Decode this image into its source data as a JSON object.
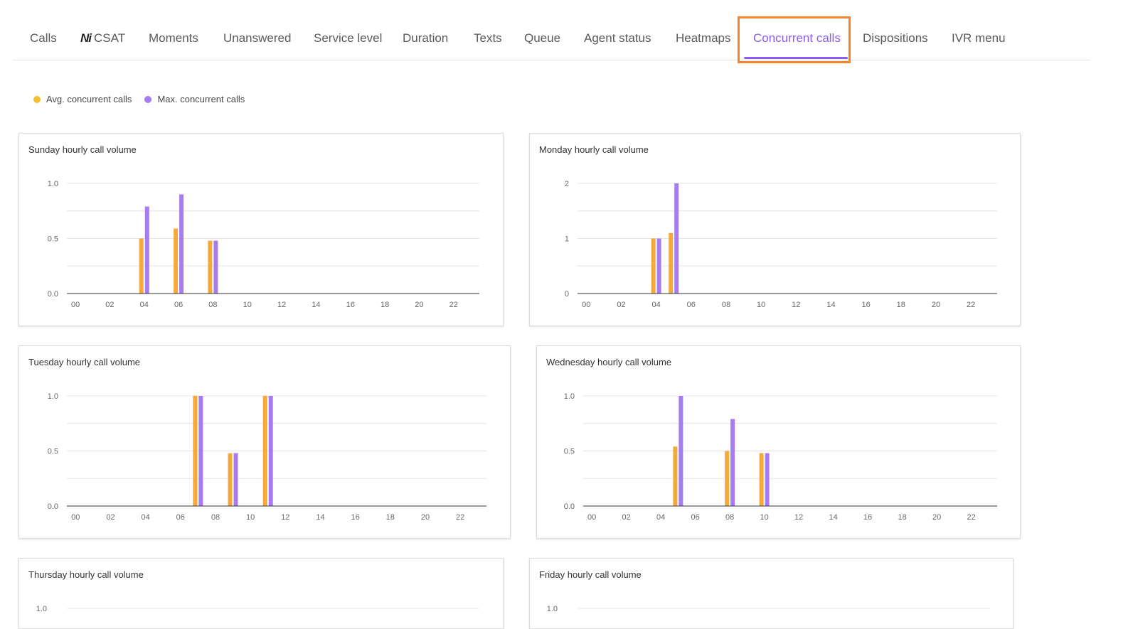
{
  "tabs": [
    {
      "label": "Calls",
      "active": false
    },
    {
      "label": "CSAT",
      "active": false,
      "logo": "Ni"
    },
    {
      "label": "Moments",
      "active": false
    },
    {
      "label": "Unanswered",
      "active": false
    },
    {
      "label": "Service level",
      "active": false
    },
    {
      "label": "Duration",
      "active": false
    },
    {
      "label": "Texts",
      "active": false
    },
    {
      "label": "Queue",
      "active": false
    },
    {
      "label": "Agent status",
      "active": false
    },
    {
      "label": "Heatmaps",
      "active": false
    },
    {
      "label": "Concurrent calls",
      "active": true
    },
    {
      "label": "Dispositions",
      "active": false
    },
    {
      "label": "IVR menu",
      "active": false
    }
  ],
  "legend": {
    "avg_label": "Avg. concurrent calls",
    "max_label": "Max. concurrent calls"
  },
  "colors": {
    "avg": "#f5a93b",
    "max": "#a67cf0",
    "accent": "#8b5cf6",
    "highlight": "#f5842a"
  },
  "chart_data": [
    {
      "type": "bar",
      "title": "Sunday hourly call volume",
      "x": [
        "00",
        "01",
        "02",
        "03",
        "04",
        "05",
        "06",
        "07",
        "08",
        "09",
        "10",
        "11",
        "12",
        "13",
        "14",
        "15",
        "16",
        "17",
        "18",
        "19",
        "20",
        "21",
        "22",
        "23"
      ],
      "xticks": [
        "00",
        "02",
        "04",
        "06",
        "08",
        "10",
        "12",
        "14",
        "16",
        "18",
        "20",
        "22"
      ],
      "yticks": [
        "0.0",
        "0.5",
        "1.0"
      ],
      "ylim": [
        0,
        1
      ],
      "series": [
        {
          "name": "Avg. concurrent calls",
          "values": {
            "04": 0.5,
            "06": 0.59,
            "08": 0.48
          }
        },
        {
          "name": "Max. concurrent calls",
          "values": {
            "04": 0.79,
            "06": 0.9,
            "08": 0.48
          }
        }
      ]
    },
    {
      "type": "bar",
      "title": "Monday hourly call volume",
      "x": [
        "00",
        "01",
        "02",
        "03",
        "04",
        "05",
        "06",
        "07",
        "08",
        "09",
        "10",
        "11",
        "12",
        "13",
        "14",
        "15",
        "16",
        "17",
        "18",
        "19",
        "20",
        "21",
        "22",
        "23"
      ],
      "xticks": [
        "00",
        "02",
        "04",
        "06",
        "08",
        "10",
        "12",
        "14",
        "16",
        "18",
        "20",
        "22"
      ],
      "yticks": [
        "0",
        "1",
        "2"
      ],
      "ylim": [
        0,
        2
      ],
      "series": [
        {
          "name": "Avg. concurrent calls",
          "values": {
            "04": 1.0,
            "05": 1.1
          }
        },
        {
          "name": "Max. concurrent calls",
          "values": {
            "04": 1.0,
            "05": 2.0
          }
        }
      ]
    },
    {
      "type": "bar",
      "title": "Tuesday hourly call volume",
      "x": [
        "00",
        "01",
        "02",
        "03",
        "04",
        "05",
        "06",
        "07",
        "08",
        "09",
        "10",
        "11",
        "12",
        "13",
        "14",
        "15",
        "16",
        "17",
        "18",
        "19",
        "20",
        "21",
        "22",
        "23"
      ],
      "xticks": [
        "00",
        "02",
        "04",
        "06",
        "08",
        "10",
        "12",
        "14",
        "16",
        "18",
        "20",
        "22"
      ],
      "yticks": [
        "0.0",
        "0.5",
        "1.0"
      ],
      "ylim": [
        0,
        1
      ],
      "series": [
        {
          "name": "Avg. concurrent calls",
          "values": {
            "07": 1.0,
            "09": 0.48,
            "11": 1.0
          }
        },
        {
          "name": "Max. concurrent calls",
          "values": {
            "07": 1.0,
            "09": 0.48,
            "11": 1.0
          }
        }
      ]
    },
    {
      "type": "bar",
      "title": "Wednesday hourly call volume",
      "x": [
        "00",
        "01",
        "02",
        "03",
        "04",
        "05",
        "06",
        "07",
        "08",
        "09",
        "10",
        "11",
        "12",
        "13",
        "14",
        "15",
        "16",
        "17",
        "18",
        "19",
        "20",
        "21",
        "22",
        "23"
      ],
      "xticks": [
        "00",
        "02",
        "04",
        "06",
        "08",
        "10",
        "12",
        "14",
        "16",
        "18",
        "20",
        "22"
      ],
      "yticks": [
        "0.0",
        "0.5",
        "1.0"
      ],
      "ylim": [
        0,
        1
      ],
      "series": [
        {
          "name": "Avg. concurrent calls",
          "values": {
            "05": 0.54,
            "08": 0.5,
            "10": 0.48
          }
        },
        {
          "name": "Max. concurrent calls",
          "values": {
            "05": 1.0,
            "08": 0.79,
            "10": 0.48
          }
        }
      ]
    },
    {
      "type": "bar",
      "title": "Thursday hourly call volume",
      "yticks": [
        "1.0"
      ],
      "series": []
    },
    {
      "type": "bar",
      "title": "Friday hourly call volume",
      "yticks": [
        "1.0"
      ],
      "series": []
    }
  ]
}
